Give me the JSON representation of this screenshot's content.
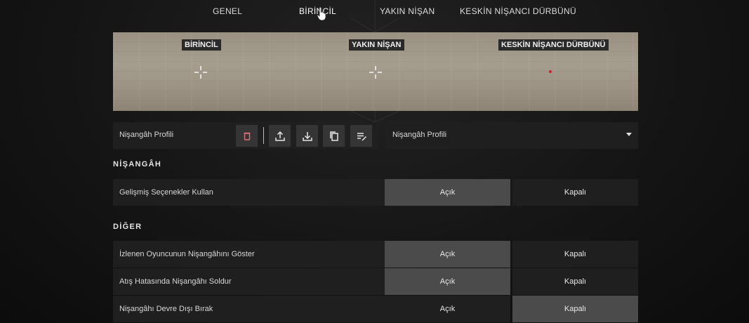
{
  "tabs": [
    {
      "label": "GENEL",
      "active": false
    },
    {
      "label": "BİRİNCİL",
      "active": true
    },
    {
      "label": "YAKIN NİŞAN",
      "active": false
    },
    {
      "label": "KESKİN NİŞANCI DÜRBÜNÜ",
      "active": false
    }
  ],
  "preview": {
    "labels": [
      "BİRİNCİL",
      "YAKIN NİŞAN",
      "KESKİN NİŞANCI DÜRBÜNÜ"
    ],
    "sniper_dot_color": "#d01e2e"
  },
  "profile": {
    "label": "Nişangâh Profili",
    "actions": [
      "trash-icon",
      "upload-icon",
      "download-icon",
      "copy-icon",
      "edit-list-icon"
    ],
    "select_value": "Nişangâh Profili"
  },
  "sections": [
    {
      "title": "NİŞANGÂH",
      "rows": [
        {
          "label": "Gelişmiş Seçenekler Kullan",
          "on": "Açık",
          "off": "Kapalı",
          "selected": "on"
        }
      ]
    },
    {
      "title": "DİĞER",
      "rows": [
        {
          "label": "İzlenen Oyuncunun Nişangâhını Göster",
          "on": "Açık",
          "off": "Kapalı",
          "selected": "on"
        },
        {
          "label": "Atış Hatasında Nişangâhı Soldur",
          "on": "Açık",
          "off": "Kapalı",
          "selected": "on"
        },
        {
          "label": "Nişangâhı Devre Dışı Bırak",
          "on": "Açık",
          "off": "Kapalı",
          "selected": "off"
        }
      ]
    }
  ],
  "colors": {
    "selected_option": "#4b4b4b",
    "panel": "#1f1f1f",
    "icon_button": "#353535",
    "trash_icon": "#e0707a"
  }
}
